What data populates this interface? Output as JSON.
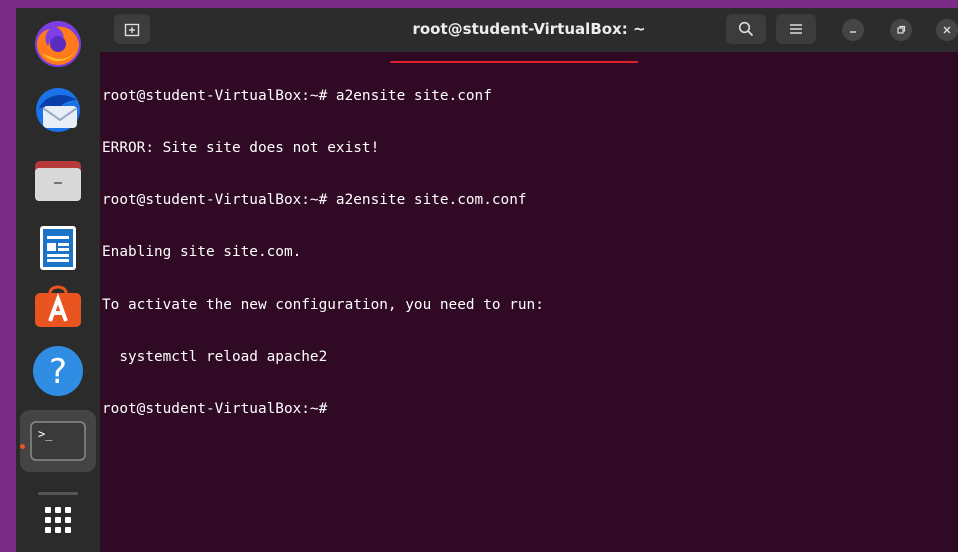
{
  "window": {
    "title": "root@student-VirtualBox: ~"
  },
  "dock": {
    "items": [
      {
        "name": "firefox-icon"
      },
      {
        "name": "thunderbird-icon"
      },
      {
        "name": "files-icon"
      },
      {
        "name": "libreoffice-writer-icon"
      },
      {
        "name": "software-center-icon"
      },
      {
        "name": "help-icon"
      },
      {
        "name": "terminal-icon",
        "active": true
      }
    ],
    "help_glyph": "?",
    "terminal_glyph": ">_"
  },
  "terminal": {
    "lines": [
      "root@student-VirtualBox:~# a2ensite site.conf",
      "ERROR: Site site does not exist!",
      "root@student-VirtualBox:~# a2ensite site.com.conf",
      "Enabling site site.com.",
      "To activate the new configuration, you need to run:",
      "  systemctl reload apache2",
      "root@student-VirtualBox:~# "
    ],
    "highlighted_command": "a2ensite site.com.conf",
    "highlight_color": "#e0202a"
  },
  "colors": {
    "desktop_bg": "#7a2d86",
    "terminal_bg": "#300a24",
    "accent": "#e95420"
  }
}
